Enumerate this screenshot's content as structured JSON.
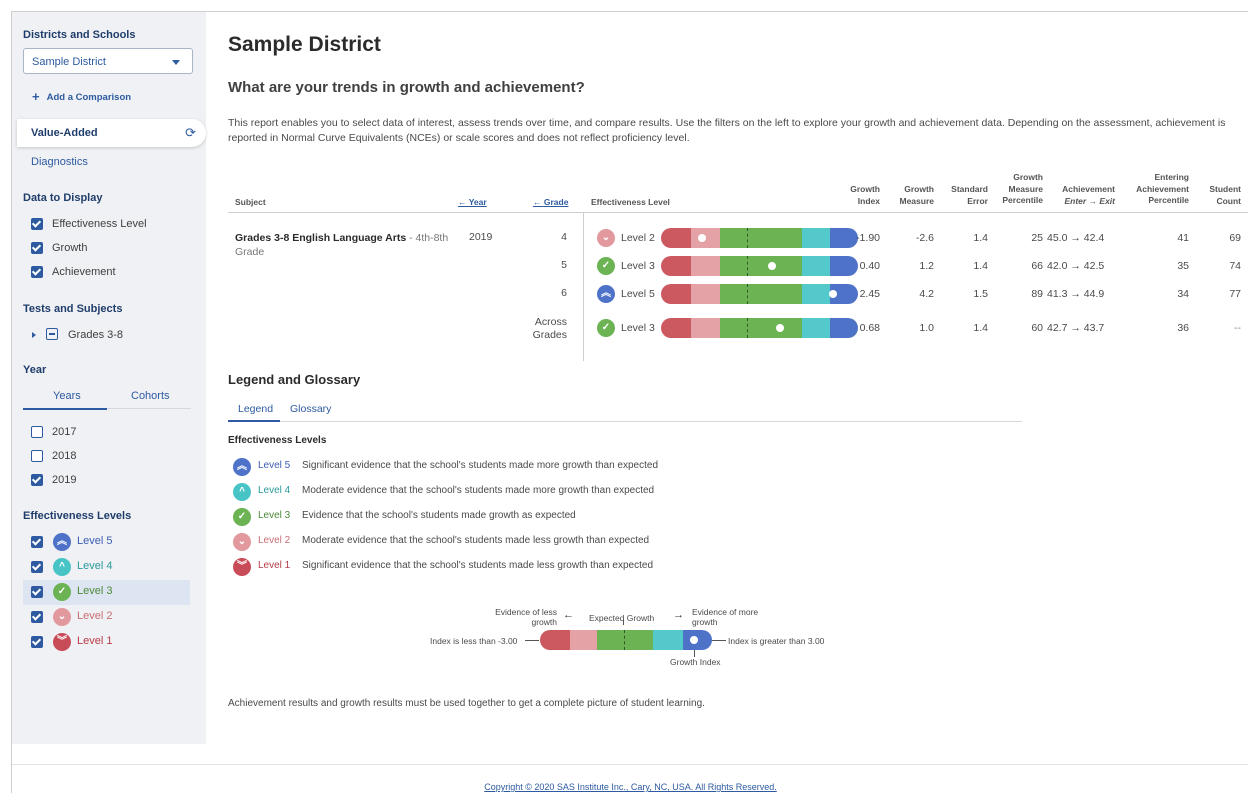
{
  "sidebar": {
    "districts_heading": "Districts and Schools",
    "district_selected": "Sample District",
    "add_comparison": "Add a Comparison",
    "tab_value_added": "Value-Added",
    "tab_diagnostics": "Diagnostics",
    "data_heading": "Data to Display",
    "data_items": [
      {
        "label": "Effectiveness Level",
        "checked": true
      },
      {
        "label": "Growth",
        "checked": true
      },
      {
        "label": "Achievement",
        "checked": true
      }
    ],
    "tests_heading": "Tests and Subjects",
    "tests_item": "Grades 3-8",
    "year_heading": "Year",
    "year_tabs": [
      "Years",
      "Cohorts"
    ],
    "years": [
      {
        "label": "2017",
        "checked": false
      },
      {
        "label": "2018",
        "checked": false
      },
      {
        "label": "2019",
        "checked": true
      }
    ],
    "levels_heading": "Effectiveness Levels",
    "levels": [
      {
        "label": "Level 5",
        "checked": true
      },
      {
        "label": "Level 4",
        "checked": true
      },
      {
        "label": "Level 3",
        "checked": true
      },
      {
        "label": "Level 2",
        "checked": true
      },
      {
        "label": "Level 1",
        "checked": true
      }
    ]
  },
  "main": {
    "title": "Sample District",
    "subtitle": "What are your trends in growth and achievement?",
    "intro": "This report enables you to select data of interest, assess trends over time, and compare results. Use the filters on the left to explore your growth and achievement data. Depending on the assessment, achievement is reported in Normal Curve Equivalents (NCEs) or scale scores and does not reflect proficiency level.",
    "table": {
      "headers": {
        "subject": "Subject",
        "year": "Year",
        "grade": "Grade",
        "effectiveness": "Effectiveness Level",
        "growth_index_1": "Growth",
        "growth_index_2": "Index",
        "growth_measure_1": "Growth",
        "growth_measure_2": "Measure",
        "std_error_1": "Standard",
        "std_error_2": "Error",
        "gm_pct_1": "Growth",
        "gm_pct_2": "Measure",
        "gm_pct_3": "Percentile",
        "achievement_1": "Achievement",
        "achievement_2": "Enter → Exit",
        "entering_1": "Entering",
        "entering_2": "Achievement",
        "entering_3": "Percentile",
        "count_1": "Student",
        "count_2": "Count"
      },
      "subject_name": "Grades 3-8 English Language Arts",
      "subject_range": "- 4th-8th",
      "subject_range_2": "Grade",
      "year": "2019",
      "rows": [
        {
          "grade": "4",
          "level": "Level 2",
          "level_num": 2,
          "index": "-1.90",
          "measure": "-2.6",
          "error": "1.4",
          "pct": "25",
          "ach": "45.0 → 42.4",
          "entering": "41",
          "count": "69",
          "index_value": -1.9
        },
        {
          "grade": "5",
          "level": "Level 3",
          "level_num": 3,
          "index": "0.40",
          "measure": "1.2",
          "error": "1.4",
          "pct": "66",
          "ach": "42.0 → 42.5",
          "entering": "35",
          "count": "74",
          "index_value": 0.4
        },
        {
          "grade": "6",
          "level": "Level 5",
          "level_num": 5,
          "index": "2.45",
          "measure": "4.2",
          "error": "1.5",
          "pct": "89",
          "ach": "41.3 → 44.9",
          "entering": "34",
          "count": "77",
          "index_value": 2.45
        },
        {
          "grade_1": "Across",
          "grade_2": "Grades",
          "level": "Level 3",
          "level_num": 3,
          "index": "0.68",
          "measure": "1.0",
          "error": "1.4",
          "pct": "60",
          "ach": "42.7 → 43.7",
          "entering": "36",
          "count": "--",
          "index_value": 0.68
        }
      ]
    },
    "legend": {
      "title": "Legend and Glossary",
      "tabs": [
        "Legend",
        "Glossary"
      ],
      "eff_heading": "Effectiveness Levels",
      "items": [
        {
          "label": "Level 5",
          "desc": "Significant evidence that the school's students made more growth than expected"
        },
        {
          "label": "Level 4",
          "desc": "Moderate evidence that the school's students made more growth than expected"
        },
        {
          "label": "Level 3",
          "desc": "Evidence that the school's students made growth as expected"
        },
        {
          "label": "Level 2",
          "desc": "Moderate evidence that the school's students made less growth than expected"
        },
        {
          "label": "Level 1",
          "desc": "Significant evidence that the school's students made less growth than expected"
        }
      ],
      "key": {
        "less_1": "Evidence of less",
        "less_2": "growth",
        "expected": "Expected Growth",
        "more_1": "Evidence of more",
        "more_2": "growth",
        "left": "Index is less than -3.00",
        "right": "Index is greater than 3.00",
        "growth_index": "Growth Index"
      }
    },
    "footnote": "Achievement results and growth results must be used together to get a complete picture of student learning."
  },
  "footer": {
    "copyright": "Copyright © 2020 SAS Institute Inc., Cary, NC, USA. All Rights Reserved."
  },
  "colors": {
    "accent": "#2d5aa0",
    "level5": "#4f72c9",
    "level4": "#54c9cb",
    "level3": "#6bb353",
    "level2": "#e4a2a6",
    "level1": "#cc5960"
  }
}
